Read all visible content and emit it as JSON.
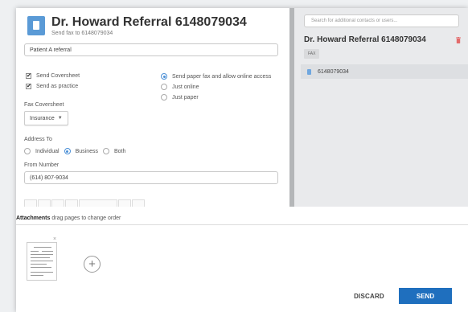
{
  "header": {
    "title": "Dr. Howard Referral 6148079034",
    "subtitle": "Send fax to 6148079034"
  },
  "subject": {
    "value": "Patient A referral"
  },
  "options": {
    "send_coversheet": {
      "label": "Send Coversheet",
      "checked": true
    },
    "send_as_practice": {
      "label": "Send as practice",
      "checked": true
    }
  },
  "delivery": {
    "paper_and_online": {
      "label": "Send paper fax and allow online access",
      "selected": true
    },
    "just_online": {
      "label": "Just online",
      "selected": false
    },
    "just_paper": {
      "label": "Just paper",
      "selected": false
    }
  },
  "coversheet": {
    "label": "Fax Coversheet",
    "selected": "Insurance"
  },
  "address_to": {
    "label": "Address To",
    "options": [
      "Individual",
      "Business",
      "Both"
    ],
    "selected": "Business"
  },
  "from_number": {
    "label": "From Number",
    "value": "(614) 807-9034"
  },
  "right": {
    "search_placeholder": "Search for additional contacts or users...",
    "contact_name": "Dr. Howard Referral 6148079034",
    "tag": "FAX",
    "fax_number": "6148079034"
  },
  "attachments": {
    "title": "Attachments",
    "hint": " drag pages to change order",
    "remove": "×",
    "add": "+"
  },
  "buttons": {
    "discard": "DISCARD",
    "send": "SEND"
  },
  "colors": {
    "accent": "#1f6fbe",
    "radio": "#4a8fd6",
    "delete": "#e36b6b"
  },
  "icons": [
    "fax-doc-icon",
    "checkmark-icon",
    "chevron-down-icon",
    "trash-icon",
    "document-icon",
    "close-icon",
    "plus-circle-icon"
  ]
}
